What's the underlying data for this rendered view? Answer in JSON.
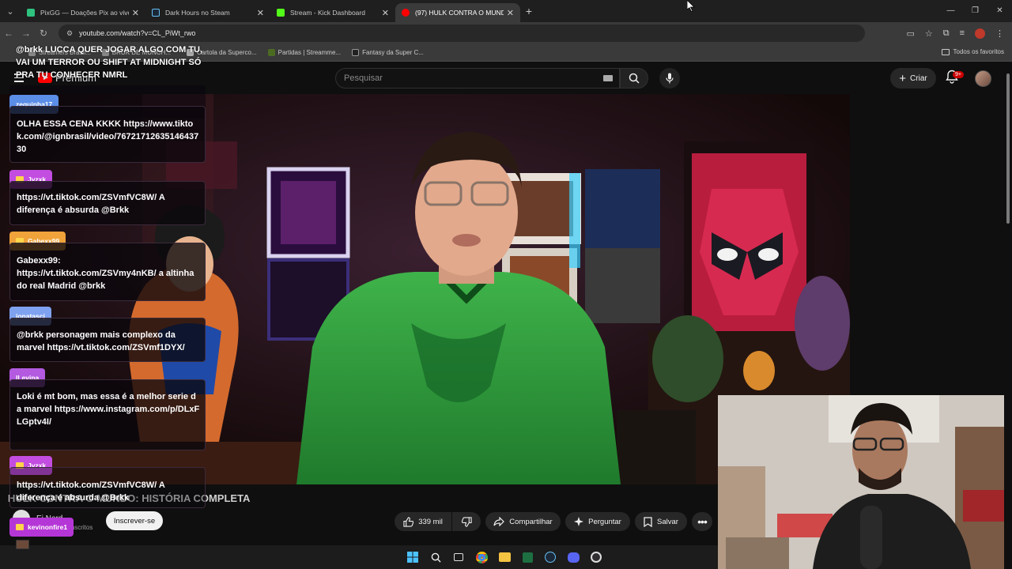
{
  "browser": {
    "tabs": [
      {
        "label": "PixGG — Doações Pix ao vivo p",
        "color": "#2ec27e"
      },
      {
        "label": "Dark Hours no Steam",
        "color": "#1b2838"
      },
      {
        "label": "Stream - Kick Dashboard",
        "color": "#53fc18"
      },
      {
        "label": "(97) HULK CONTRA O MUNDO",
        "color": "#ff0000"
      }
    ],
    "url": "youtube.com/watch?v=CL_PiWt_rwo",
    "bookmarks": [
      "Streamers Brasil...",
      "BRUK DE MUNCH...",
      "Cartola da Superco...",
      "Partidas | Streamme...",
      "Fantasy da Super C..."
    ],
    "bookmarks_right": "Todos os favoritos"
  },
  "youtube": {
    "logo_text": "Premium",
    "search_placeholder": "Pesquisar",
    "create_label": "Criar",
    "notif_badge": "9+",
    "video_title": "HULK CONTRA O MUNDO: HISTÓRIA COMPLETA",
    "channel_name": "Ei Nerd",
    "channel_subs": "inscritos",
    "subscribe_label": "Inscrever-se",
    "like_count": "339 mil",
    "share_label": "Compartilhar",
    "ask_label": "Perguntar",
    "save_label": "Salvar"
  },
  "chat": {
    "top_message": "@brkk LUCCA QUER JOGAR ALGO COM TU, VAI UM TERROR OU SHIFT AT MIDNIGHT SÓ PRA TU CONHECER NMRL",
    "messages": [
      {
        "user": "zequinha17",
        "badge_color": "#5b8ee6",
        "text": "OLHA ESSA CENA KKKK https://www.tiktok.com/@ignbrasil/video/7672171263514643730"
      },
      {
        "user": "Jvzxk",
        "badge_color": "#c34de0",
        "text": "https://vt.tiktok.com/ZSVmfVC8W/ A diferença é absurda @Brkk"
      },
      {
        "user": "Gabexx99",
        "badge_color": "#f0a33a",
        "text": "Gabexx99: https://vt.tiktok.com/ZSVmy4nKB/ a altinha do real Madrid @brkk"
      },
      {
        "user": "jonatascj",
        "badge_color": "#7fa2f0",
        "text": "@brkk personagem mais complexo da marvel https://vt.tiktok.com/ZSVmf1DYX/"
      },
      {
        "user": "ILevina",
        "badge_color": "#b35ae0",
        "text": "Loki é mt bom, mas essa é a melhor serie da marvel https://www.instagram.com/p/DLxFLGptv4I/"
      },
      {
        "user": "Jvzxk",
        "badge_color": "#c34de0",
        "text": "https://vt.tiktok.com/ZSVmfVC8W/ A diferença é absurda @Brkk"
      },
      {
        "user": "kevinonfire1",
        "badge_color": "#b536d6",
        "text": ""
      }
    ]
  }
}
